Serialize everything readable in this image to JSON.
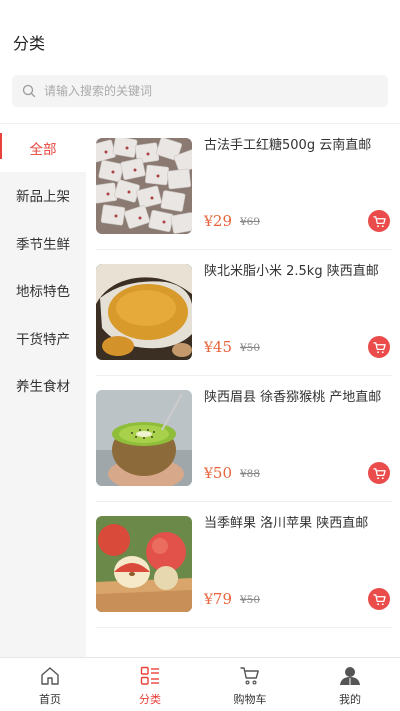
{
  "header": {
    "title": "分类"
  },
  "search": {
    "placeholder": "请输入搜索的关键词"
  },
  "sidebar": {
    "items": [
      {
        "label": "全部",
        "active": true
      },
      {
        "label": "新品上架"
      },
      {
        "label": "季节生鲜"
      },
      {
        "label": "地标特色"
      },
      {
        "label": "干货特产"
      },
      {
        "label": "养生食材"
      }
    ]
  },
  "products": [
    {
      "name": "古法手工红糖500g 云南直邮",
      "currency": "¥",
      "price": "29",
      "old_price": "¥69",
      "image": "brown-sugar-photo"
    },
    {
      "name": "陕北米脂小米 2.5kg 陕西直邮",
      "currency": "¥",
      "price": "45",
      "old_price": "¥50",
      "image": "millet-photo"
    },
    {
      "name": "陕西眉县 徐香猕猴桃 产地直邮",
      "currency": "¥",
      "price": "50",
      "old_price": "¥88",
      "image": "kiwi-photo"
    },
    {
      "name": "当季鲜果 洛川苹果 陕西直邮",
      "currency": "¥",
      "price": "79",
      "old_price": "¥50",
      "image": "apple-photo"
    }
  ],
  "tabbar": {
    "items": [
      {
        "label": "首页",
        "icon": "home-icon"
      },
      {
        "label": "分类",
        "icon": "category-icon",
        "active": true
      },
      {
        "label": "购物车",
        "icon": "cart-icon"
      },
      {
        "label": "我的",
        "icon": "user-icon"
      }
    ]
  },
  "colors": {
    "accent": "#e8423b",
    "price": "#e8643b",
    "cart_button": "#ea4c4c",
    "sidebar_bg": "#f5f5f5"
  }
}
